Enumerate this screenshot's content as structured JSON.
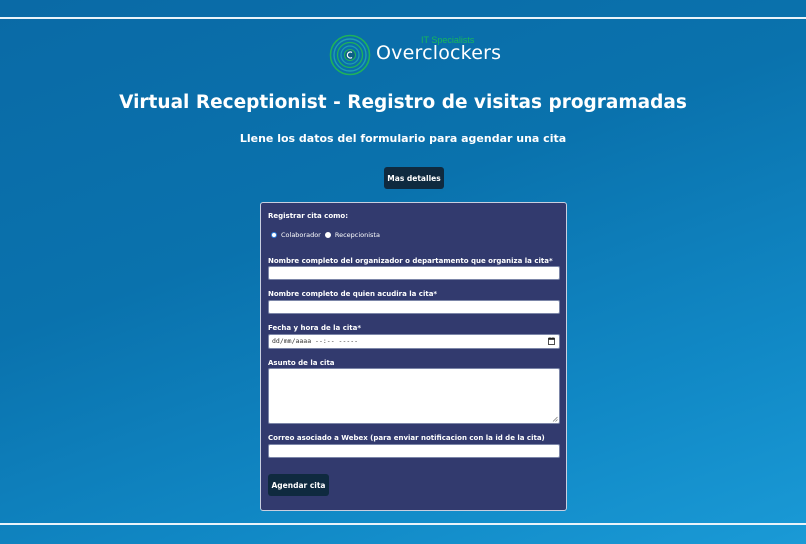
{
  "logo": {
    "tagline": "IT Specialists",
    "name": "Overclockers"
  },
  "header": {
    "title": "Virtual Receptionist - Registro de visitas programadas",
    "subtitle": "Llene los datos del formulario para agendar una cita",
    "details_button": "Mas detalles"
  },
  "form": {
    "register_as_label": "Registrar cita como:",
    "options": [
      {
        "label": "Colaborador",
        "selected": true
      },
      {
        "label": "Recepcionista",
        "selected": false
      }
    ],
    "organizer_label": "Nombre completo del organizador o departamento que organiza la cita*",
    "organizer_value": "",
    "attendee_label": "Nombre completo de quien acudira la cita*",
    "attendee_value": "",
    "datetime_label": "Fecha y hora de la cita*",
    "datetime_placeholder": "dd/mm/aaaa --:-- -----",
    "subject_label": "Asunto de la cita",
    "subject_value": "",
    "webex_label": "Correo asociado a Webex (para enviar notificacion con la id de la cita)",
    "webex_value": "",
    "submit_button": "Agendar cita"
  },
  "icons": {
    "logo": "overclockers-logo-icon",
    "calendar": "calendar-icon",
    "resize": "resize-handle-icon"
  },
  "colors": {
    "background": "#0a72ad",
    "panel": "#323a6e",
    "button": "#0f2a3f",
    "accent_green": "#17b85a"
  }
}
